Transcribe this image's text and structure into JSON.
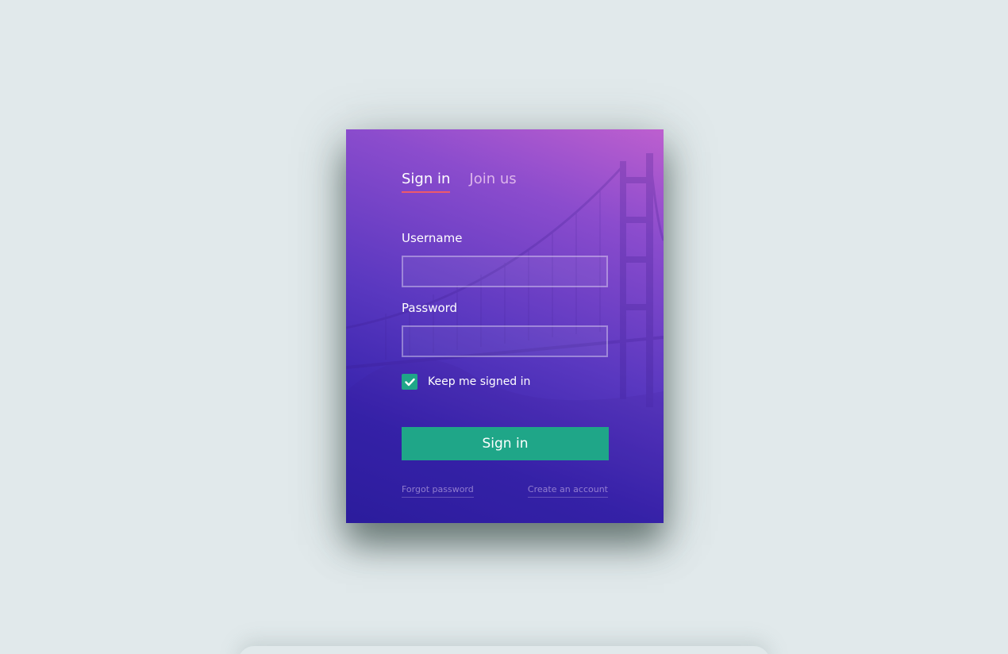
{
  "tabs": [
    {
      "label": "Sign in",
      "active": true
    },
    {
      "label": "Join us",
      "active": false
    }
  ],
  "form": {
    "username_label": "Username",
    "username_value": "",
    "password_label": "Password",
    "password_value": "",
    "keep_signed_in_label": "Keep me signed in",
    "keep_signed_in_checked": true,
    "submit_label": "Sign in"
  },
  "links": {
    "forgot_password": "Forgot password",
    "create_account": "Create an account"
  },
  "colors": {
    "page_background": "#e1e9eb",
    "accent": "#1fa688",
    "active_tab_underline": "#ee5a6a",
    "card_gradient_top": "#bd5fcf",
    "card_gradient_bottom": "#2a1d9f"
  },
  "icons": {
    "checkbox": "check-icon",
    "background": "golden-gate-bridge-illustration"
  }
}
